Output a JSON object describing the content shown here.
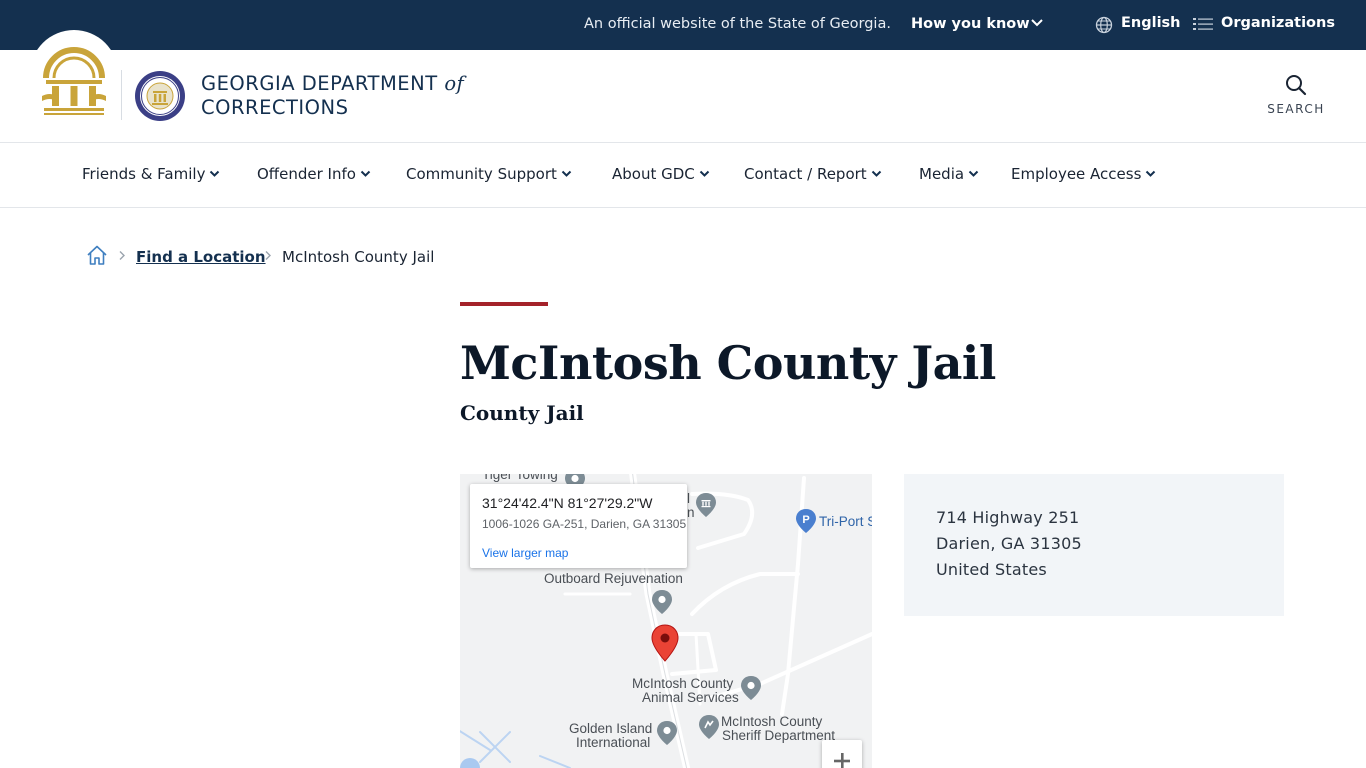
{
  "topbar": {
    "official_text": "An official website of the State of Georgia.",
    "how_you_know": "How you know",
    "language": "English",
    "organizations": "Organizations"
  },
  "header": {
    "brand_line1": "GEORGIA DEPARTMENT",
    "brand_of": "of",
    "brand_line2": "CORRECTIONS",
    "search_label": "SEARCH"
  },
  "nav": {
    "items": [
      {
        "label": "Friends & Family"
      },
      {
        "label": "Offender Info"
      },
      {
        "label": "Community Support"
      },
      {
        "label": "About GDC"
      },
      {
        "label": "Contact / Report"
      },
      {
        "label": "Media"
      },
      {
        "label": "Employee Access"
      }
    ]
  },
  "breadcrumb": {
    "link": "Find a Location",
    "current": "McIntosh County Jail"
  },
  "page": {
    "title": "McIntosh County Jail",
    "subtitle": "County Jail"
  },
  "map": {
    "card": {
      "coords": "31°24'42.4\"N 81°27'29.2\"W",
      "address": "1006-1026 GA-251, Darien, GA 31305",
      "larger_link": "View larger map"
    },
    "labels": {
      "tiger_towing": "Tiger Towing",
      "tri_port": "Tri-Port S",
      "outboard": "Outboard Rejuvenation",
      "animal_1": "McIntosh County",
      "animal_2": "Animal Services",
      "golden_1": "Golden Island",
      "golden_2": "International",
      "sheriff_1": "McIntosh County",
      "sheriff_2": "Sheriff Department",
      "partial_l1": "l",
      "partial_l2": "n"
    },
    "colors": {
      "pin_red": "#ea4335",
      "poi_gray": "#7d8c95",
      "poi_blue": "#4a7fcf",
      "road": "#ffffff"
    }
  },
  "address": {
    "line1": "714 Highway 251",
    "line2": "Darien, GA 31305",
    "line3": "United States"
  },
  "colors": {
    "topbar_bg": "#14304f",
    "accent_red": "#a4222a",
    "brand_navy": "#14304f",
    "seal_gold": "#c9a43a",
    "address_bg": "#f2f5f8"
  },
  "icons": [
    "chevron-down-icon",
    "globe-icon",
    "list-icon",
    "search-icon",
    "home-icon",
    "chevron-right-icon",
    "map-pin-icon",
    "parking-icon",
    "plus-icon"
  ]
}
